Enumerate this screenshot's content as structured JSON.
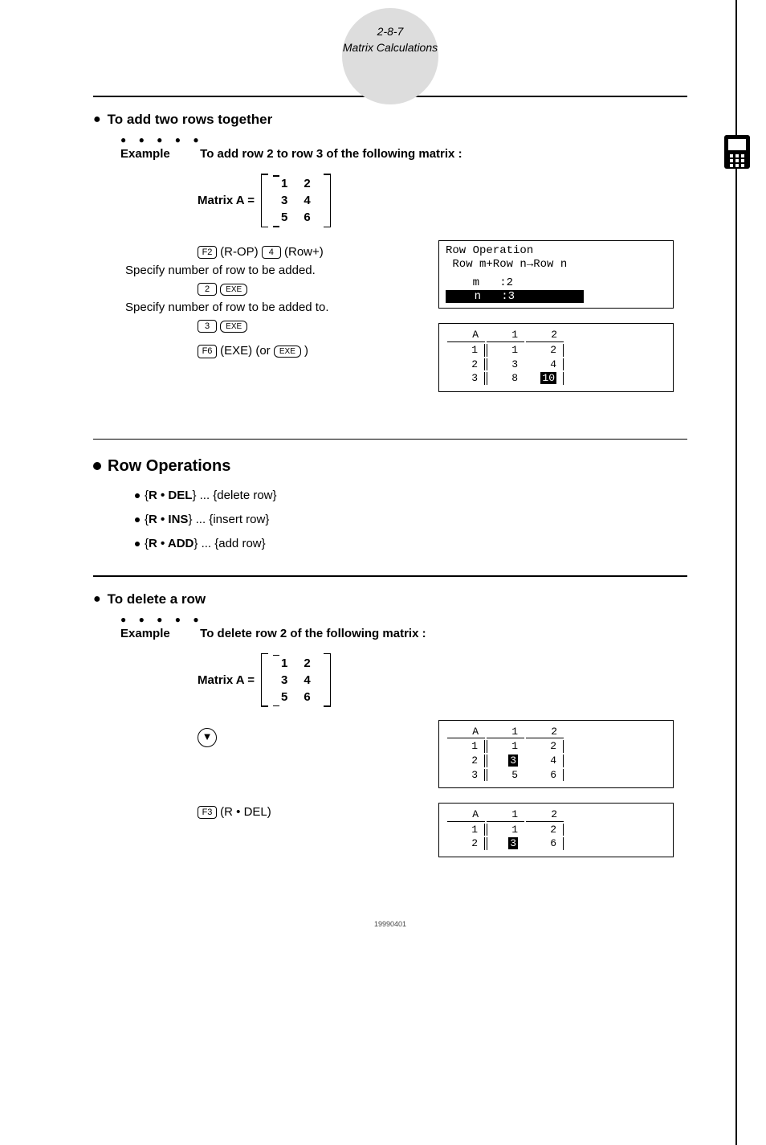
{
  "header": {
    "page_ref": "2-8-7",
    "title": "Matrix Calculations"
  },
  "section1": {
    "title": "To add two rows together",
    "example_label": "Example",
    "example_text": "To add row 2 to row 3 of the following matrix :",
    "matrix_label": "Matrix A =",
    "matrix": [
      [
        "1",
        "2"
      ],
      [
        "3",
        "4"
      ],
      [
        "5",
        "6"
      ]
    ],
    "step1_key1": "F2",
    "step1_txt1": "(R-OP)",
    "step1_key2": "4",
    "step1_txt2": "(Row+)",
    "instr1": "Specify number of row to be added.",
    "step2_key1": "2",
    "step2_key2": "EXE",
    "instr2": "Specify number of row to be added to.",
    "step3_key1": "3",
    "step3_key2": "EXE",
    "step4_key1": "F6",
    "step4_txt1": "(EXE) (or",
    "step4_key2": "EXE",
    "step4_txt2": ")",
    "lcd1": {
      "l1": "Row Operation",
      "l2": " Row m+Row n→Row n",
      "l3_left": "    m   :",
      "l3_val": "2",
      "l4_label": "    n   :",
      "l4_val": "3"
    },
    "lcd2": {
      "name": "A",
      "cols": [
        "1",
        "2"
      ],
      "rows": [
        {
          "h": "1",
          "c": [
            "1",
            "2"
          ]
        },
        {
          "h": "2",
          "c": [
            "3",
            "4"
          ]
        },
        {
          "h": "3",
          "c": [
            "8",
            "10"
          ]
        }
      ],
      "hl_row": 2,
      "hl_col": 1
    }
  },
  "section2": {
    "title": "Row Operations",
    "items": [
      {
        "op": "R • DEL",
        "desc": "delete row"
      },
      {
        "op": "R • INS",
        "desc": "insert row"
      },
      {
        "op": "R • ADD",
        "desc": "add row"
      }
    ]
  },
  "section3": {
    "title": "To delete a row",
    "example_label": "Example",
    "example_text": "To delete row 2 of the following matrix :",
    "matrix_label": "Matrix A =",
    "matrix": [
      [
        "1",
        "2"
      ],
      [
        "3",
        "4"
      ],
      [
        "5",
        "6"
      ]
    ],
    "lcd1": {
      "name": "A",
      "cols": [
        "1",
        "2"
      ],
      "rows": [
        {
          "h": "1",
          "c": [
            "1",
            "2"
          ]
        },
        {
          "h": "2",
          "c": [
            "3",
            "4"
          ]
        },
        {
          "h": "3",
          "c": [
            "5",
            "6"
          ]
        }
      ],
      "hl_row": 1,
      "hl_col": 0
    },
    "step2_key": "F3",
    "step2_txt": "(R • DEL)",
    "lcd2": {
      "name": "A",
      "cols": [
        "1",
        "2"
      ],
      "rows": [
        {
          "h": "1",
          "c": [
            "1",
            "2"
          ]
        },
        {
          "h": "2",
          "c": [
            "3",
            "6"
          ]
        }
      ],
      "hl_row": 1,
      "hl_col": 0
    }
  },
  "footer": "19990401"
}
